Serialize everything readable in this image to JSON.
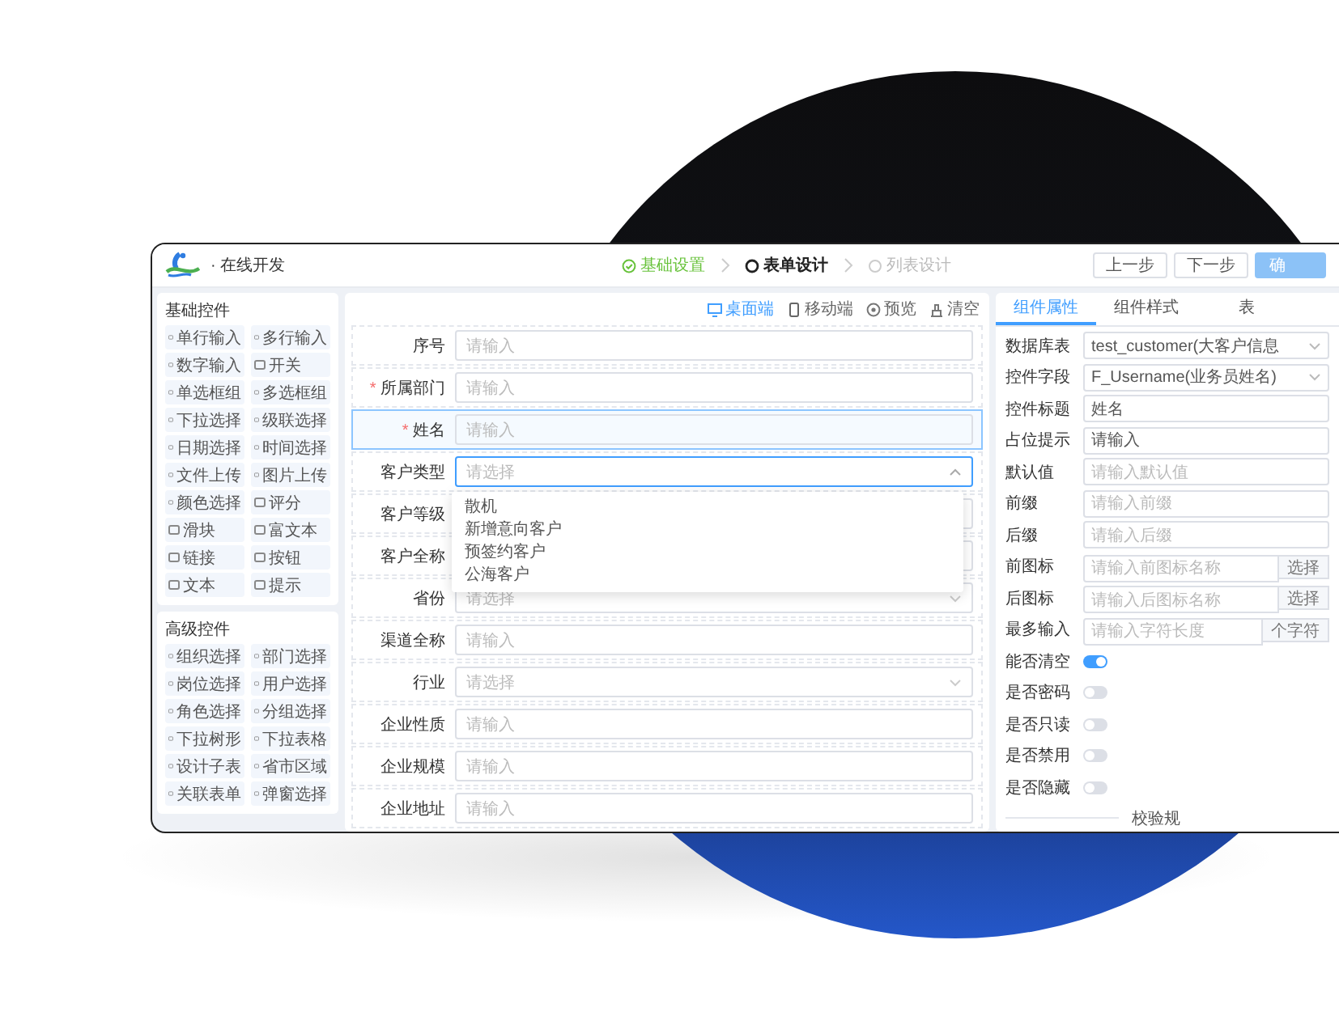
{
  "header": {
    "app_title": "· 在线开发",
    "steps": [
      {
        "label": "基础设置",
        "done": true,
        "selected": false
      },
      {
        "label": "表单设计",
        "done": false,
        "selected": true
      },
      {
        "label": "列表设计",
        "done": false,
        "selected": false
      }
    ],
    "buttons": [
      {
        "label": "上一步",
        "kind": "default"
      },
      {
        "label": "下一步",
        "kind": "default"
      },
      {
        "label": "确",
        "kind": "primary"
      }
    ]
  },
  "palette": [
    {
      "title": "基础控件",
      "items": [
        "单行输入",
        "多行输入",
        "数字输入",
        "开关",
        "单选框组",
        "多选框组",
        "下拉选择",
        "级联选择",
        "日期选择",
        "时间选择",
        "文件上传",
        "图片上传",
        "颜色选择",
        "评分",
        "滑块",
        "富文本",
        "链接",
        "按钮",
        "文本",
        "提示"
      ]
    },
    {
      "title": "高级控件",
      "items": [
        "组织选择",
        "部门选择",
        "岗位选择",
        "用户选择",
        "角色选择",
        "分组选择",
        "下拉树形",
        "下拉表格",
        "设计子表",
        "省市区域",
        "关联表单",
        "弹窗选择"
      ]
    }
  ],
  "toolbar": {
    "view_modes": [
      {
        "label": "桌面端",
        "selected": true
      },
      {
        "label": "移动端",
        "selected": false
      }
    ],
    "actions": [
      "预览",
      "清空"
    ]
  },
  "form": {
    "rows": [
      {
        "label": "序号",
        "kind": "input",
        "placeholder": "请输入",
        "selected": false
      },
      {
        "required_mark": "*",
        "label": "所属部门",
        "kind": "input",
        "placeholder": "请输入",
        "selected": false
      },
      {
        "required_mark": "*",
        "label": "姓名",
        "kind": "input",
        "placeholder": "请输入",
        "selected": true
      },
      {
        "label": "客户类型",
        "kind": "select",
        "placeholder": "请选择",
        "selected": false,
        "expanded": true,
        "options": [
          "散机",
          "新增意向客户",
          "预签约客户",
          "公海客户"
        ]
      },
      {
        "label": "客户等级",
        "kind": "input",
        "selected": false
      },
      {
        "label": "客户全称",
        "kind": "input",
        "selected": false
      },
      {
        "label": "省份",
        "kind": "select",
        "placeholder": "请选择",
        "selected": false,
        "expanded": false
      },
      {
        "label": "渠道全称",
        "kind": "input",
        "placeholder": "请输入",
        "selected": false
      },
      {
        "label": "行业",
        "kind": "select",
        "placeholder": "请选择",
        "selected": false,
        "expanded": false
      },
      {
        "label": "企业性质",
        "kind": "input",
        "placeholder": "请输入",
        "selected": false
      },
      {
        "label": "企业规模",
        "kind": "input",
        "placeholder": "请输入",
        "selected": false
      },
      {
        "label": "企业地址",
        "kind": "input",
        "placeholder": "请输入",
        "selected": false
      }
    ]
  },
  "properties": {
    "tabs": [
      {
        "label": "组件属性",
        "selected": true
      },
      {
        "label": "组件样式",
        "selected": false
      },
      {
        "label": "表",
        "selected": false
      }
    ],
    "rows": [
      {
        "label": "数据库表",
        "kind": "select",
        "value": "test_customer(大客户信息"
      },
      {
        "label": "控件字段",
        "kind": "select",
        "value": "F_Username(业务员姓名)"
      },
      {
        "label": "控件标题",
        "kind": "input",
        "value": "姓名"
      },
      {
        "label": "占位提示",
        "kind": "input",
        "value": "请输入"
      },
      {
        "label": "默认值",
        "kind": "input",
        "placeholder": "请输入默认值"
      },
      {
        "label": "前缀",
        "kind": "input",
        "placeholder": "请输入前缀"
      },
      {
        "label": "后缀",
        "kind": "input",
        "placeholder": "请输入后缀"
      },
      {
        "label": "前图标",
        "kind": "addon",
        "placeholder": "请输入前图标名称",
        "addon": "选择"
      },
      {
        "label": "后图标",
        "kind": "addon",
        "placeholder": "请输入后图标名称",
        "addon": "选择"
      },
      {
        "label": "最多输入",
        "kind": "addon",
        "placeholder": "请输入字符长度",
        "addon": "个字符"
      },
      {
        "label": "能否清空",
        "kind": "switch",
        "on": true
      },
      {
        "label": "是否密码",
        "kind": "switch",
        "on": false
      },
      {
        "label": "是否只读",
        "kind": "switch",
        "on": false
      },
      {
        "label": "是否禁用",
        "kind": "switch",
        "on": false
      },
      {
        "label": "是否隐藏",
        "kind": "switch",
        "on": false
      }
    ],
    "divider": "校验规"
  }
}
